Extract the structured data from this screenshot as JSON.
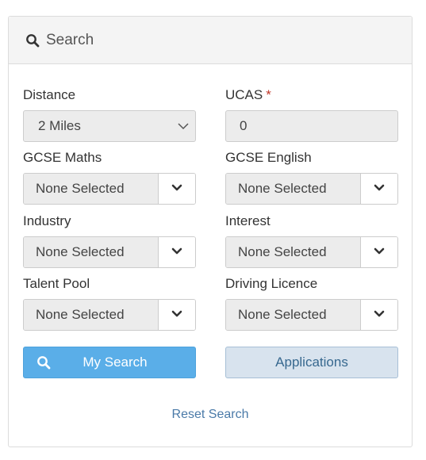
{
  "header": {
    "title": "Search",
    "icon": "search-icon"
  },
  "fields": {
    "distance": {
      "label": "Distance",
      "value": "2 Miles"
    },
    "ucas": {
      "label": "UCAS",
      "required_mark": "*",
      "value": "0"
    },
    "gcse_maths": {
      "label": "GCSE Maths",
      "value": "None Selected"
    },
    "gcse_english": {
      "label": "GCSE English",
      "value": "None Selected"
    },
    "industry": {
      "label": "Industry",
      "value": "None Selected"
    },
    "interest": {
      "label": "Interest",
      "value": "None Selected"
    },
    "talent_pool": {
      "label": "Talent Pool",
      "value": "None Selected"
    },
    "driving_licence": {
      "label": "Driving Licence",
      "value": "None Selected"
    }
  },
  "buttons": {
    "my_search": "My Search",
    "applications": "Applications",
    "reset": "Reset Search"
  },
  "colors": {
    "primary": "#5aaee8",
    "secondary": "#d8e3ee",
    "link": "#4a7aa8",
    "required": "#c0392b"
  }
}
